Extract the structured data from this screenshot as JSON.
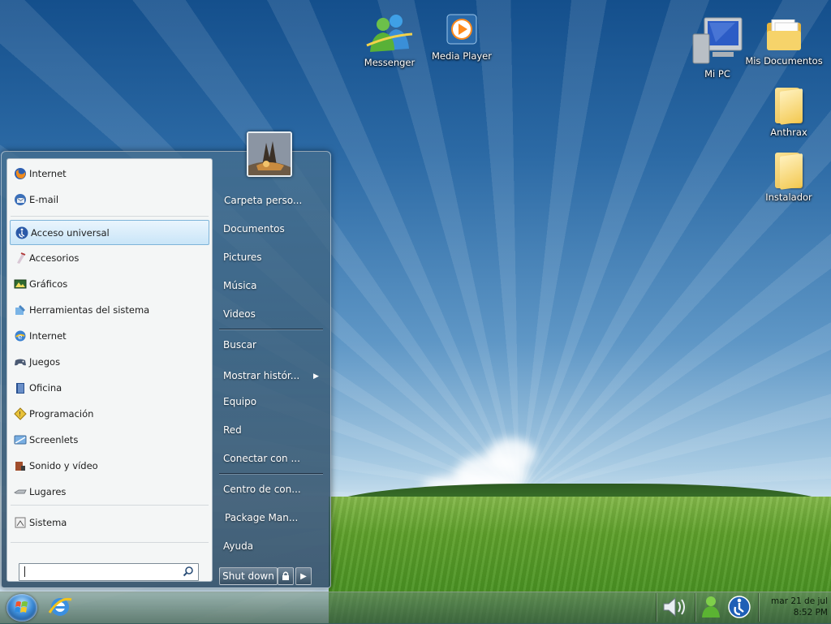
{
  "desktop": {
    "icons": [
      {
        "label": "Messenger"
      },
      {
        "label": "Media Player"
      },
      {
        "label": "Mi PC"
      },
      {
        "label": "Mis Documentos"
      },
      {
        "label": "Anthrax"
      },
      {
        "label": "Instalador"
      }
    ]
  },
  "start_menu": {
    "pinned": [
      {
        "label": "Internet",
        "icon": "firefox-icon"
      },
      {
        "label": "E-mail",
        "icon": "thunderbird-icon"
      }
    ],
    "programs": [
      {
        "label": "Acceso universal",
        "icon": "accessibility-icon",
        "selected": true
      },
      {
        "label": "Accesorios",
        "icon": "accessories-icon"
      },
      {
        "label": "Gráficos",
        "icon": "graphics-icon"
      },
      {
        "label": "Herramientas del sistema",
        "icon": "system-tools-icon"
      },
      {
        "label": "Internet",
        "icon": "internet-icon"
      },
      {
        "label": "Juegos",
        "icon": "gamepad-icon"
      },
      {
        "label": "Oficina",
        "icon": "office-icon"
      },
      {
        "label": "Programación",
        "icon": "programming-icon"
      },
      {
        "label": "Screenlets",
        "icon": "screenlets-icon"
      },
      {
        "label": "Sonido y vídeo",
        "icon": "sound-video-icon"
      },
      {
        "label": "Lugares",
        "icon": "places-icon"
      },
      {
        "label": "Sistema",
        "icon": "system-icon"
      }
    ],
    "search": {
      "placeholder": ""
    },
    "right_items": [
      {
        "label": "Carpeta perso..."
      },
      {
        "label": "Documentos"
      },
      {
        "label": "Pictures"
      },
      {
        "label": "Música"
      },
      {
        "label": "Videos"
      },
      {
        "label": "Buscar"
      },
      {
        "label": "Mostrar histór..."
      },
      {
        "label": "Equipo"
      },
      {
        "label": "Red"
      },
      {
        "label": "Conectar con ..."
      },
      {
        "label": "Centro de con..."
      },
      {
        "label": "Package Man..."
      },
      {
        "label": "Ayuda"
      }
    ],
    "shutdown_label": "Shut down"
  },
  "taskbar": {
    "clock": {
      "date": "mar 21 de jul",
      "time": "8:52 PM"
    }
  },
  "colors": {
    "accent": "#3d8bd6",
    "selection": "#c9e5f8"
  }
}
